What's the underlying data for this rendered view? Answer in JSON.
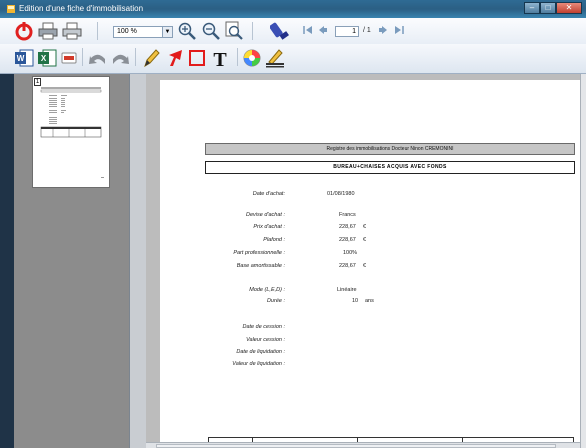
{
  "window": {
    "title": "Edition d'une fiche d'immobilisation",
    "min_label": "–",
    "max_label": "□",
    "close_label": "✕"
  },
  "toolbar": {
    "zoom": "100 %",
    "page_current": "1",
    "page_total": "/ 1"
  },
  "thumbnail": {
    "page_number": "1"
  },
  "document": {
    "header": "Registre des immobilisations Docteur Ninon CREMONINI",
    "asset_title": "BUREAU+CHAISES ACQUIS AVEC FONDS",
    "fields": [
      {
        "label": "Date d'achat:",
        "value": "01/08/1980",
        "unit": ""
      },
      {
        "label": "Devise d'achat :",
        "value": "Francs",
        "unit": ""
      },
      {
        "label": "Prix d'achat :",
        "value": "228,67",
        "unit": "€"
      },
      {
        "label": "Plafond :",
        "value": "228,67",
        "unit": "€"
      },
      {
        "label": "Part professionnelle :",
        "value": "100%",
        "unit": ""
      },
      {
        "label": "Base amortissable :",
        "value": "228,67",
        "unit": "€"
      },
      {
        "label": "Mode (L,E,D) :",
        "value": "Linéaire",
        "unit": ""
      },
      {
        "label": "Durée :",
        "value": "10",
        "unit": "ans"
      },
      {
        "label": "Date de cession :",
        "value": "",
        "unit": ""
      },
      {
        "label": "Valeur cession :",
        "value": "",
        "unit": ""
      },
      {
        "label": "Date de liquidation :",
        "value": "",
        "unit": ""
      },
      {
        "label": "Valeur de liquidation :",
        "value": "",
        "unit": ""
      }
    ]
  },
  "colors": {
    "title_bar": "#2b5f84",
    "viewer_bg": "#bcbcbc",
    "sidebar_bg": "#8c8c8c",
    "header_box": "#c6c6c6"
  }
}
